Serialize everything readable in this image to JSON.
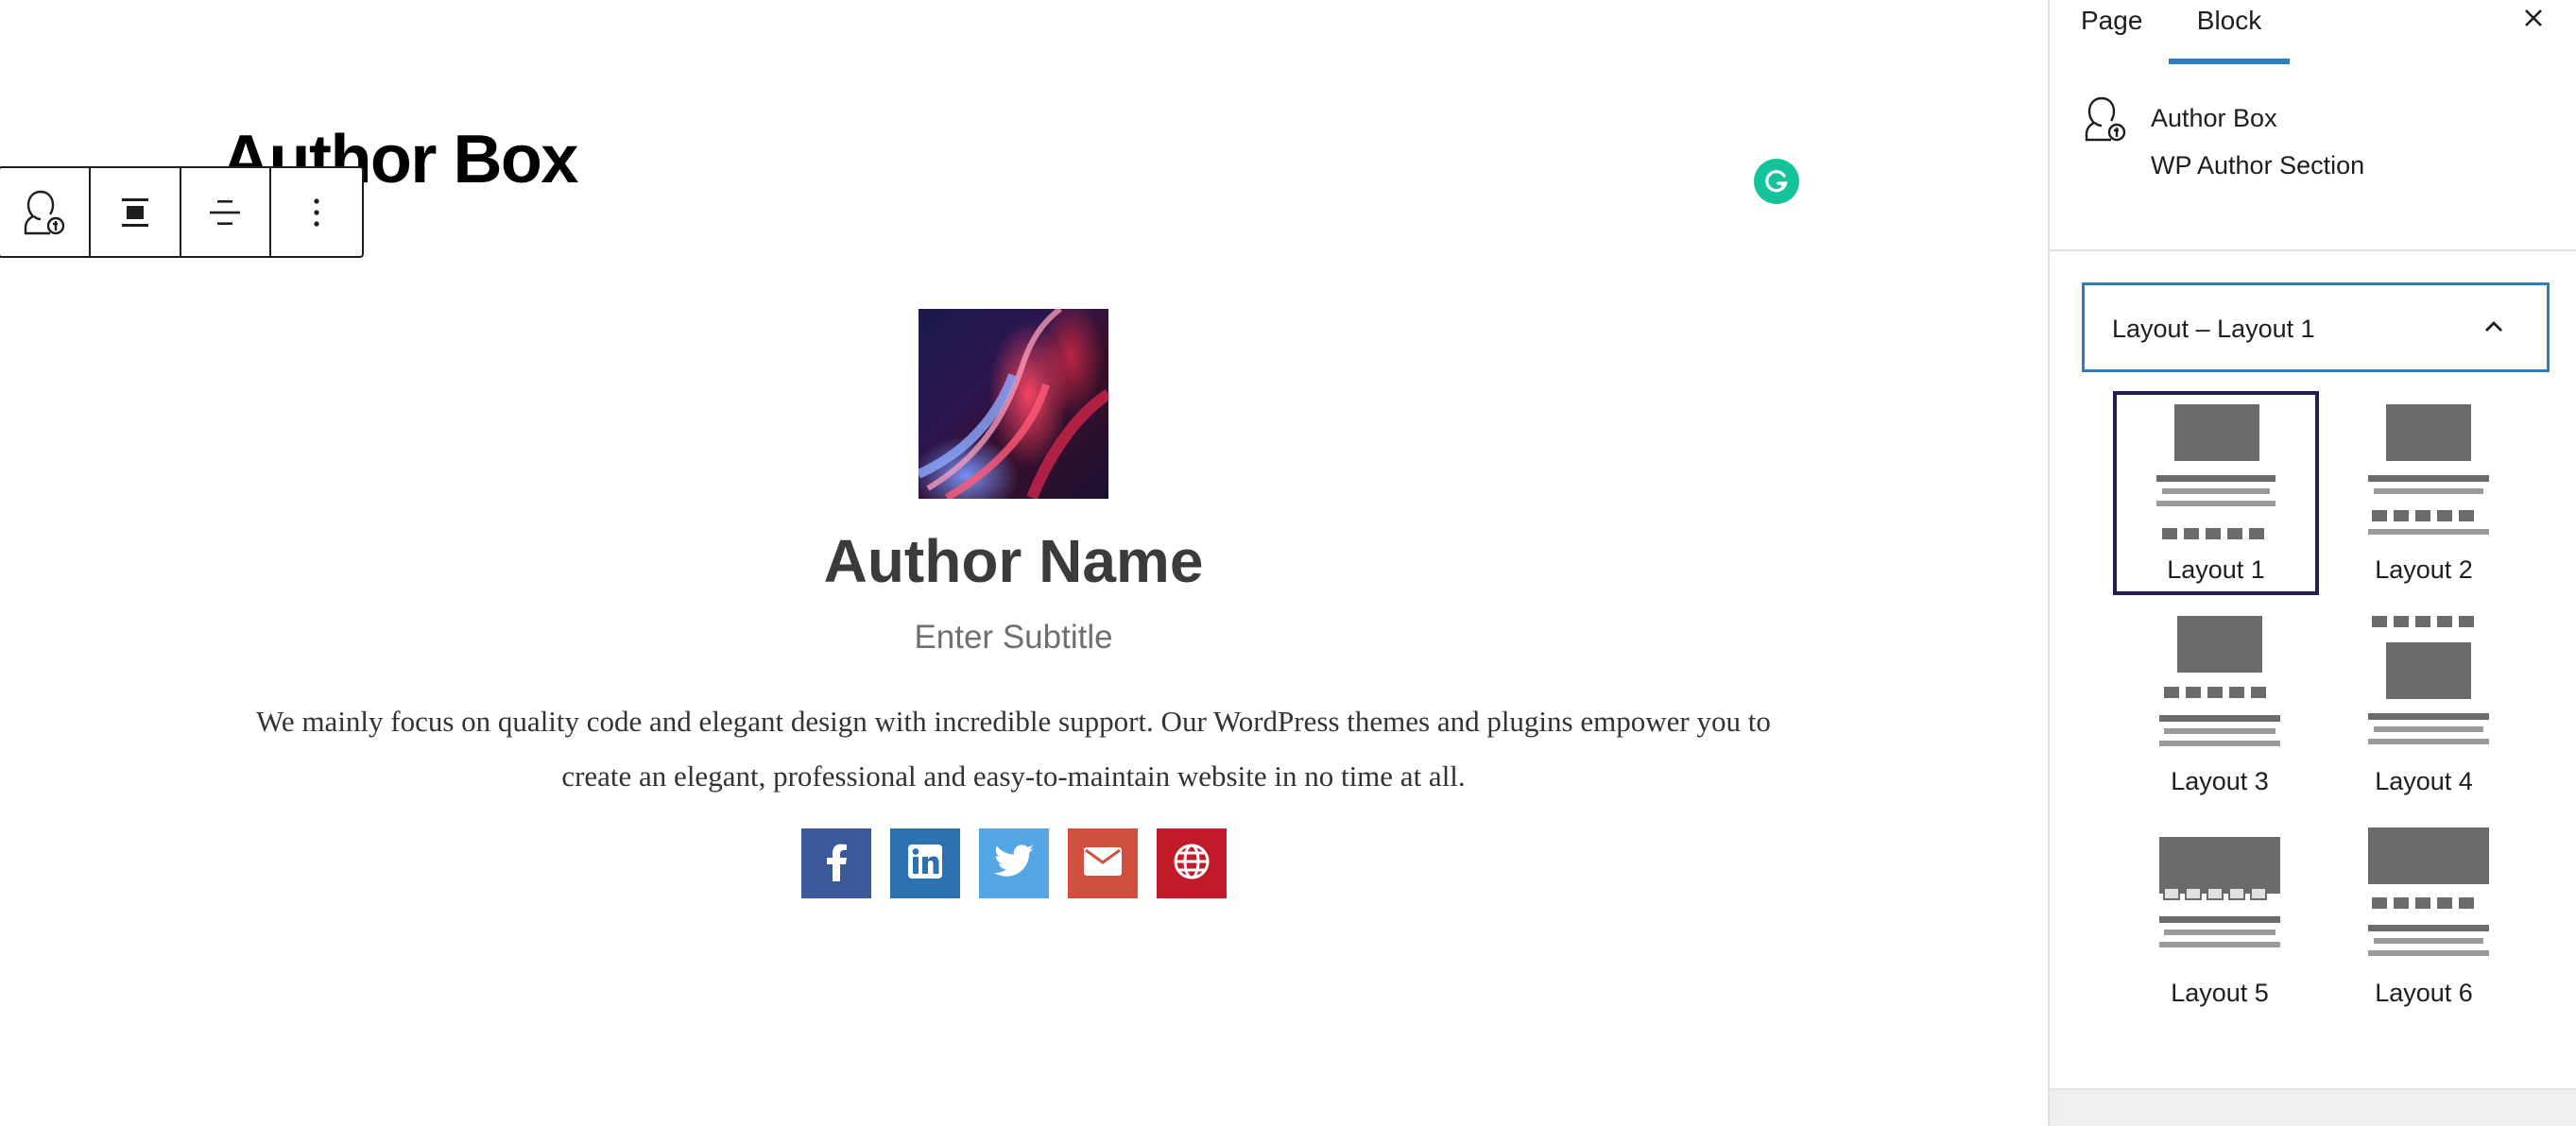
{
  "page": {
    "title": "Author Box"
  },
  "block_toolbar": {
    "items": [
      "author-box-block-icon",
      "align-center-icon",
      "text-align-icon",
      "more-options-icon"
    ]
  },
  "author_card": {
    "name": "Author Name",
    "subtitle": "Enter Subtitle",
    "bio": "We mainly focus on quality code and elegant design with incredible support. Our WordPress themes and plugins empower you to create an elegant, professional and easy-to-maintain website in no time at all.",
    "social": [
      {
        "name": "facebook-icon",
        "color": "#3b5998"
      },
      {
        "name": "linkedin-icon",
        "color": "#2d72b0"
      },
      {
        "name": "twitter-icon",
        "color": "#55a6e4"
      },
      {
        "name": "email-icon",
        "color": "#d14f3e"
      },
      {
        "name": "website-icon",
        "color": "#c11a28"
      }
    ]
  },
  "sidebar": {
    "tabs": [
      {
        "label": "Page",
        "active": false
      },
      {
        "label": "Block",
        "active": true
      }
    ],
    "block_card": {
      "title": "Author Box",
      "description": "WP Author Section"
    },
    "layout_panel": {
      "title": "Layout – Layout 1",
      "expanded": true,
      "options": [
        {
          "label": "Layout 1",
          "selected": true
        },
        {
          "label": "Layout 2",
          "selected": false
        },
        {
          "label": "Layout 3",
          "selected": false
        },
        {
          "label": "Layout 4",
          "selected": false
        },
        {
          "label": "Layout 5",
          "selected": false
        },
        {
          "label": "Layout 6",
          "selected": false
        }
      ]
    }
  },
  "colors": {
    "accent": "#2e7cc4",
    "selected_border": "#2a1a52",
    "thumb_dark": "#6b6b6b",
    "thumb_light": "#9a9a9a",
    "grammarly": "#15c39a"
  }
}
